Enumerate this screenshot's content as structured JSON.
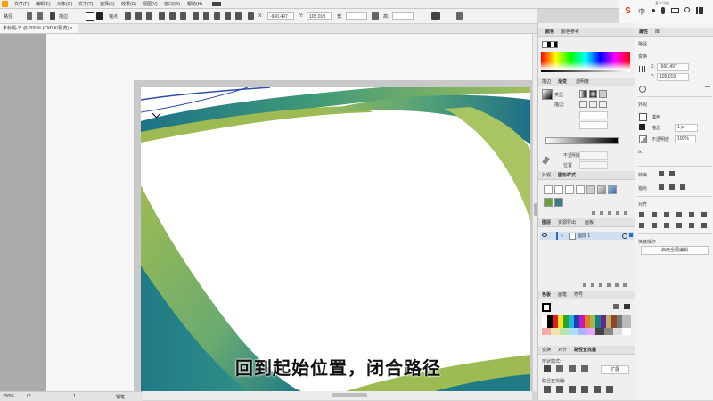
{
  "menu": [
    "文件(F)",
    "编辑(E)",
    "对象(O)",
    "文字(T)",
    "选择(S)",
    "效果(C)",
    "视图(V)",
    "窗口(W)",
    "帮助(H)"
  ],
  "system": {
    "sogou_label": "中",
    "top_right": "基本功能"
  },
  "options_bar": {
    "group1": "路径",
    "stroke_label": "描边",
    "x_label": "X:",
    "x_value": "-960.497",
    "y_label": "Y:",
    "y_value": "105.019",
    "w_label": "宽:",
    "h_label": "高:"
  },
  "document_tab": "未标题-1* @ 200 % (CMYK/预览)",
  "status": {
    "zoom": "200%",
    "angle": "0°",
    "page": "1",
    "tool": "钢笔"
  },
  "panels": {
    "color": {
      "tabs": [
        "颜色",
        "颜色参考"
      ]
    },
    "gradient": {
      "tabs": [
        "描边",
        "渐变",
        "透明度"
      ],
      "type_label": "类型:",
      "stroke_label": "描边:",
      "opacity_label": "不透明度",
      "position_label": "位置"
    },
    "appearance": {
      "tabs": [
        "外观",
        "图形样式"
      ]
    },
    "layers": {
      "tabs": [
        "图层",
        "资源导出",
        "画板"
      ],
      "layer_name": "图层 1"
    },
    "swatches": {
      "tabs": [
        "色板",
        "画笔",
        "符号"
      ]
    },
    "pathfinder": {
      "tabs": [
        "变换",
        "对齐",
        "路径查找器"
      ],
      "shape_modes": "形状模式:",
      "pathfinders": "路径查找器:",
      "expand": "扩展"
    }
  },
  "properties": {
    "tabs": [
      "属性",
      "库"
    ],
    "path_label": "路径",
    "transform_label": "变换",
    "x": "-960.497",
    "y": "105.019",
    "appearance_label": "外观",
    "fill_label": "填色",
    "stroke_label": "描边",
    "stroke_value": "1 pt",
    "opacity_label": "不透明度",
    "opacity_value": "100%",
    "fx": "fx.",
    "anchor_label": "锚点",
    "align_label": "对齐",
    "quick_actions": "快速操作",
    "action_button": "启动全局编辑"
  },
  "subtitle": "回到起始位置，闭合路径",
  "colors": {
    "teal": "#1d7f86",
    "green": "#9dbb52",
    "accent": "#2f66c8"
  }
}
